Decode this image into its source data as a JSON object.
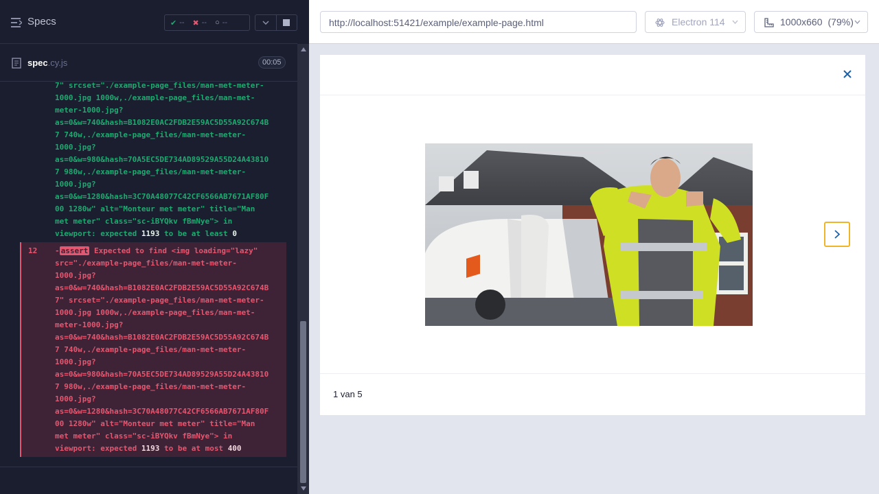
{
  "sidebar": {
    "title": "Specs",
    "stats": {
      "passed": "--",
      "failed": "--",
      "pending": "--"
    },
    "spec_file": {
      "name": "spec",
      "ext": ".cy.js"
    },
    "timer": "00:05"
  },
  "log": {
    "pass_lines": [
      "7\" srcset=\"./example-page_files/man-met-meter-",
      "1000.jpg 1000w,./example-page_files/man-met-",
      "meter-1000.jpg?",
      "as=0&w=740&hash=B1082E0AC2FDB2E59AC5D55A92C674B",
      "7 740w,./example-page_files/man-met-meter-",
      "1000.jpg?",
      "as=0&w=980&hash=70A5EC5DE734AD89529A55D24A43810",
      "7 980w,./example-page_files/man-met-meter-",
      "1000.jpg?",
      "as=0&w=1280&hash=3C70A48077C42CF6566AB7671AF80F",
      "00 1280w\" alt=\"Monteur met meter\" title=\"Man",
      "met meter\" class=\"sc-iBYQkv fBmNye\"> in"
    ],
    "pass_last": {
      "prefix": "viewport: expected ",
      "val1": "1193",
      "mid": " to be at least ",
      "val2": "0"
    },
    "fail": {
      "number": "12",
      "badge": "assert",
      "first_line": " Expected to find <img loading=\"lazy\"",
      "lines": [
        "src=\"./example-page_files/man-met-meter-",
        "1000.jpg?",
        "as=0&w=740&hash=B1082E0AC2FDB2E59AC5D55A92C674B",
        "7\" srcset=\"./example-page_files/man-met-meter-",
        "1000.jpg 1000w,./example-page_files/man-met-",
        "meter-1000.jpg?",
        "as=0&w=740&hash=B1082E0AC2FDB2E59AC5D55A92C674B",
        "7 740w,./example-page_files/man-met-meter-",
        "1000.jpg?",
        "as=0&w=980&hash=70A5EC5DE734AD89529A55D24A43810",
        "7 980w,./example-page_files/man-met-meter-",
        "1000.jpg?",
        "as=0&w=1280&hash=3C70A48077C42CF6566AB7671AF80F",
        "00 1280w\" alt=\"Monteur met meter\" title=\"Man",
        "met meter\" class=\"sc-iBYQkv fBmNye\"> in"
      ],
      "last": {
        "prefix": "viewport: expected ",
        "val1": "1193",
        "mid": " to be at most ",
        "val2": "400"
      }
    }
  },
  "toolbar": {
    "url": "http://localhost:51421/example/example-page.html",
    "browser": "Electron 114",
    "viewport": "1000x660",
    "zoom": "(79%)"
  },
  "app": {
    "counter": "1 van 5",
    "photo_alt": "Monteur met meter"
  },
  "colors": {
    "accent_focus": "#f0b429",
    "pass": "#1fa971",
    "fail": "#e45770"
  }
}
